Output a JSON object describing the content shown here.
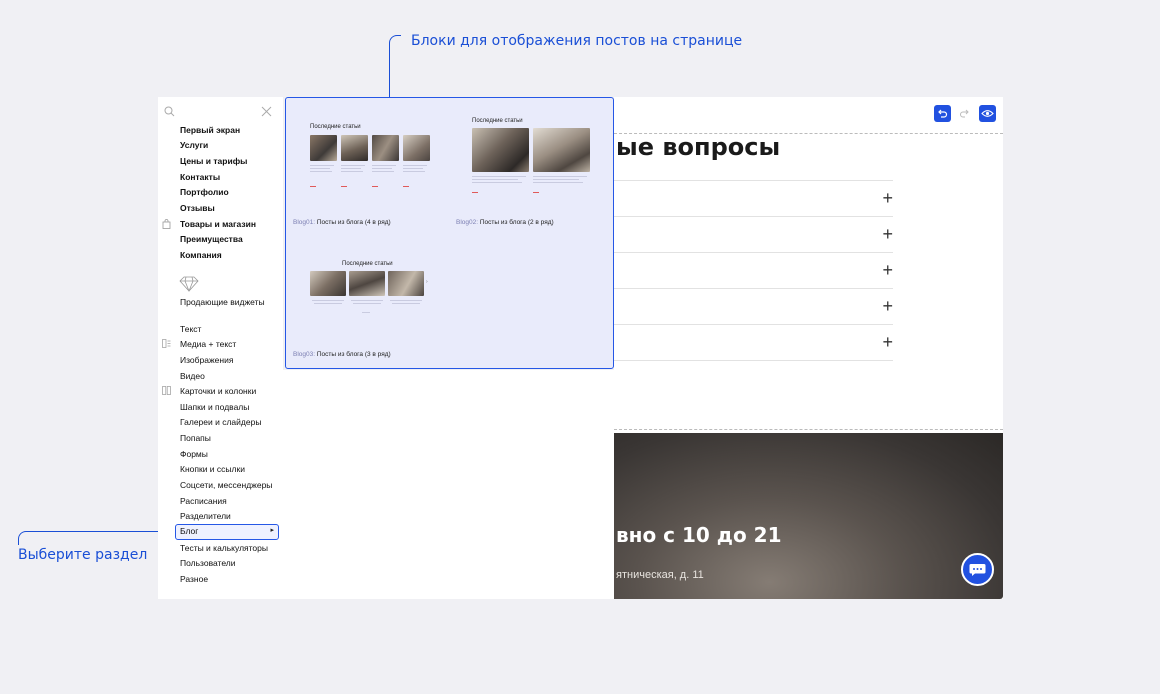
{
  "annotations": {
    "top": "Блоки для отображения постов на странице",
    "left": "Выберите раздел"
  },
  "sidebar": {
    "items": [
      {
        "label": "Первый экран",
        "bold": true
      },
      {
        "label": "Услуги",
        "bold": true
      },
      {
        "label": "Цены и тарифы",
        "bold": true
      },
      {
        "label": "Контакты",
        "bold": true
      },
      {
        "label": "Портфолио",
        "bold": true
      },
      {
        "label": "Отзывы",
        "bold": true
      },
      {
        "label": "Товары и магазин",
        "bold": true
      },
      {
        "label": "Преимущества",
        "bold": true
      },
      {
        "label": "Компания",
        "bold": true
      }
    ],
    "selling_label": "Продающие виджеты",
    "sections": [
      "Текст",
      "Медиа + текст",
      "Изображения",
      "Видео",
      "Карточки и колонки",
      "Шапки и подвалы",
      "Галереи и слайдеры",
      "Попапы",
      "Формы",
      "Кнопки и ссылки",
      "Соцсети, мессенджеры",
      "Расписания",
      "Разделители",
      "Блог",
      "Тесты и калькуляторы",
      "Пользователи",
      "Разное"
    ],
    "selected_section": "Блог"
  },
  "blocks": [
    {
      "id": "Blog01:",
      "name": "Посты из блога (4 в ряд)",
      "mini_title": "Последние статьи"
    },
    {
      "id": "Blog02:",
      "name": "Посты из блога (2 в ряд)",
      "mini_title": "Последние статьи"
    },
    {
      "id": "Blog03:",
      "name": "Посты из блога (3 в ряд)",
      "mini_title": "Последние статьи"
    }
  ],
  "editor": {
    "faq_title": "ые вопросы",
    "faq_rows": 5,
    "hero_title": "вно с 10 до 21",
    "hero_address": "ятническая, д. 11"
  },
  "colors": {
    "accent": "#2557e6",
    "panel_bg": "#e9ebfb",
    "page_bg": "#f0f0f4"
  }
}
